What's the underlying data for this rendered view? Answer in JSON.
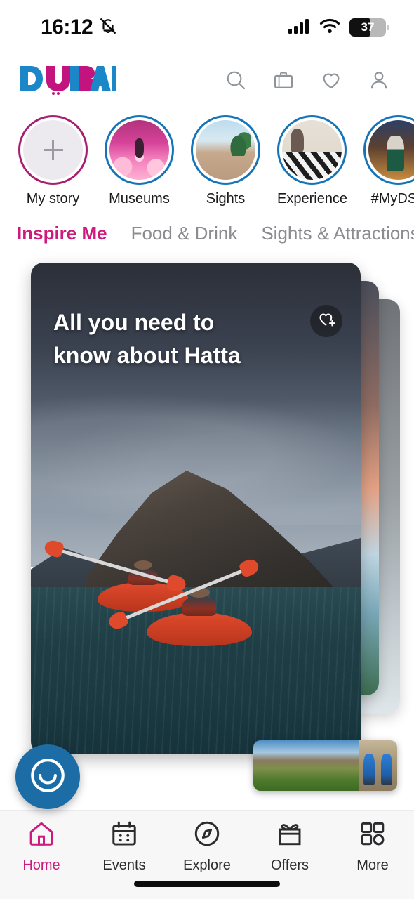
{
  "status_bar": {
    "time": "16:12",
    "silent_icon": "bell-slash-icon",
    "cellular_icon": "cellular-bars-icon",
    "wifi_icon": "wifi-icon",
    "battery_level": "37",
    "battery_percent": 37
  },
  "header": {
    "logo_text": "DUBAI",
    "logo_colors": {
      "blue": "#1b86c8",
      "magenta": "#c2137e"
    },
    "icons": [
      {
        "name": "search-icon",
        "label": "Search"
      },
      {
        "name": "briefcase-icon",
        "label": "My Trips"
      },
      {
        "name": "heart-icon",
        "label": "Favourites"
      },
      {
        "name": "profile-icon",
        "label": "Account"
      }
    ]
  },
  "stories": [
    {
      "label": "My story",
      "ring": "pink",
      "thumb": "add-story",
      "icon": "plus-icon"
    },
    {
      "label": "Museums",
      "ring": "blue",
      "thumb": "th-museums"
    },
    {
      "label": "Sights",
      "ring": "blue",
      "thumb": "th-sights"
    },
    {
      "label": "Experience",
      "ring": "blue",
      "thumb": "th-experience"
    },
    {
      "label": "#MyDSF",
      "ring": "blue",
      "thumb": "th-dsf"
    }
  ],
  "category_tabs": [
    {
      "label": "Inspire Me",
      "active": true
    },
    {
      "label": "Food & Drink",
      "active": false
    },
    {
      "label": "Sights & Attractions",
      "active": false
    }
  ],
  "hero_card": {
    "title_line1": "All you need to",
    "title_line2": "know about Hatta",
    "save_icon": "heart-plus-icon",
    "image_description": "Two kayakers paddling red kayaks on dark water below Hatta mountains"
  },
  "chat_fab": {
    "icon": "smile-chat-icon",
    "color": "#1c6ca5"
  },
  "hero_thumbs": [
    {
      "name": "thumb-resort",
      "description": "Hatta resort and green valley"
    },
    {
      "name": "thumb-people",
      "description": "Visitors in blue jackets"
    }
  ],
  "bottom_nav": [
    {
      "label": "Home",
      "icon": "home-icon",
      "active": true
    },
    {
      "label": "Events",
      "icon": "calendar-icon",
      "active": false
    },
    {
      "label": "Explore",
      "icon": "compass-icon",
      "active": false
    },
    {
      "label": "Offers",
      "icon": "gift-icon",
      "active": false
    },
    {
      "label": "More",
      "icon": "grid-icon",
      "active": false
    }
  ],
  "theme": {
    "accent_magenta": "#cf1a7d",
    "accent_blue": "#1574b8",
    "nav_bg": "#f7f7f8",
    "text_primary": "#1a1a1a",
    "text_muted": "#8b8b90"
  }
}
